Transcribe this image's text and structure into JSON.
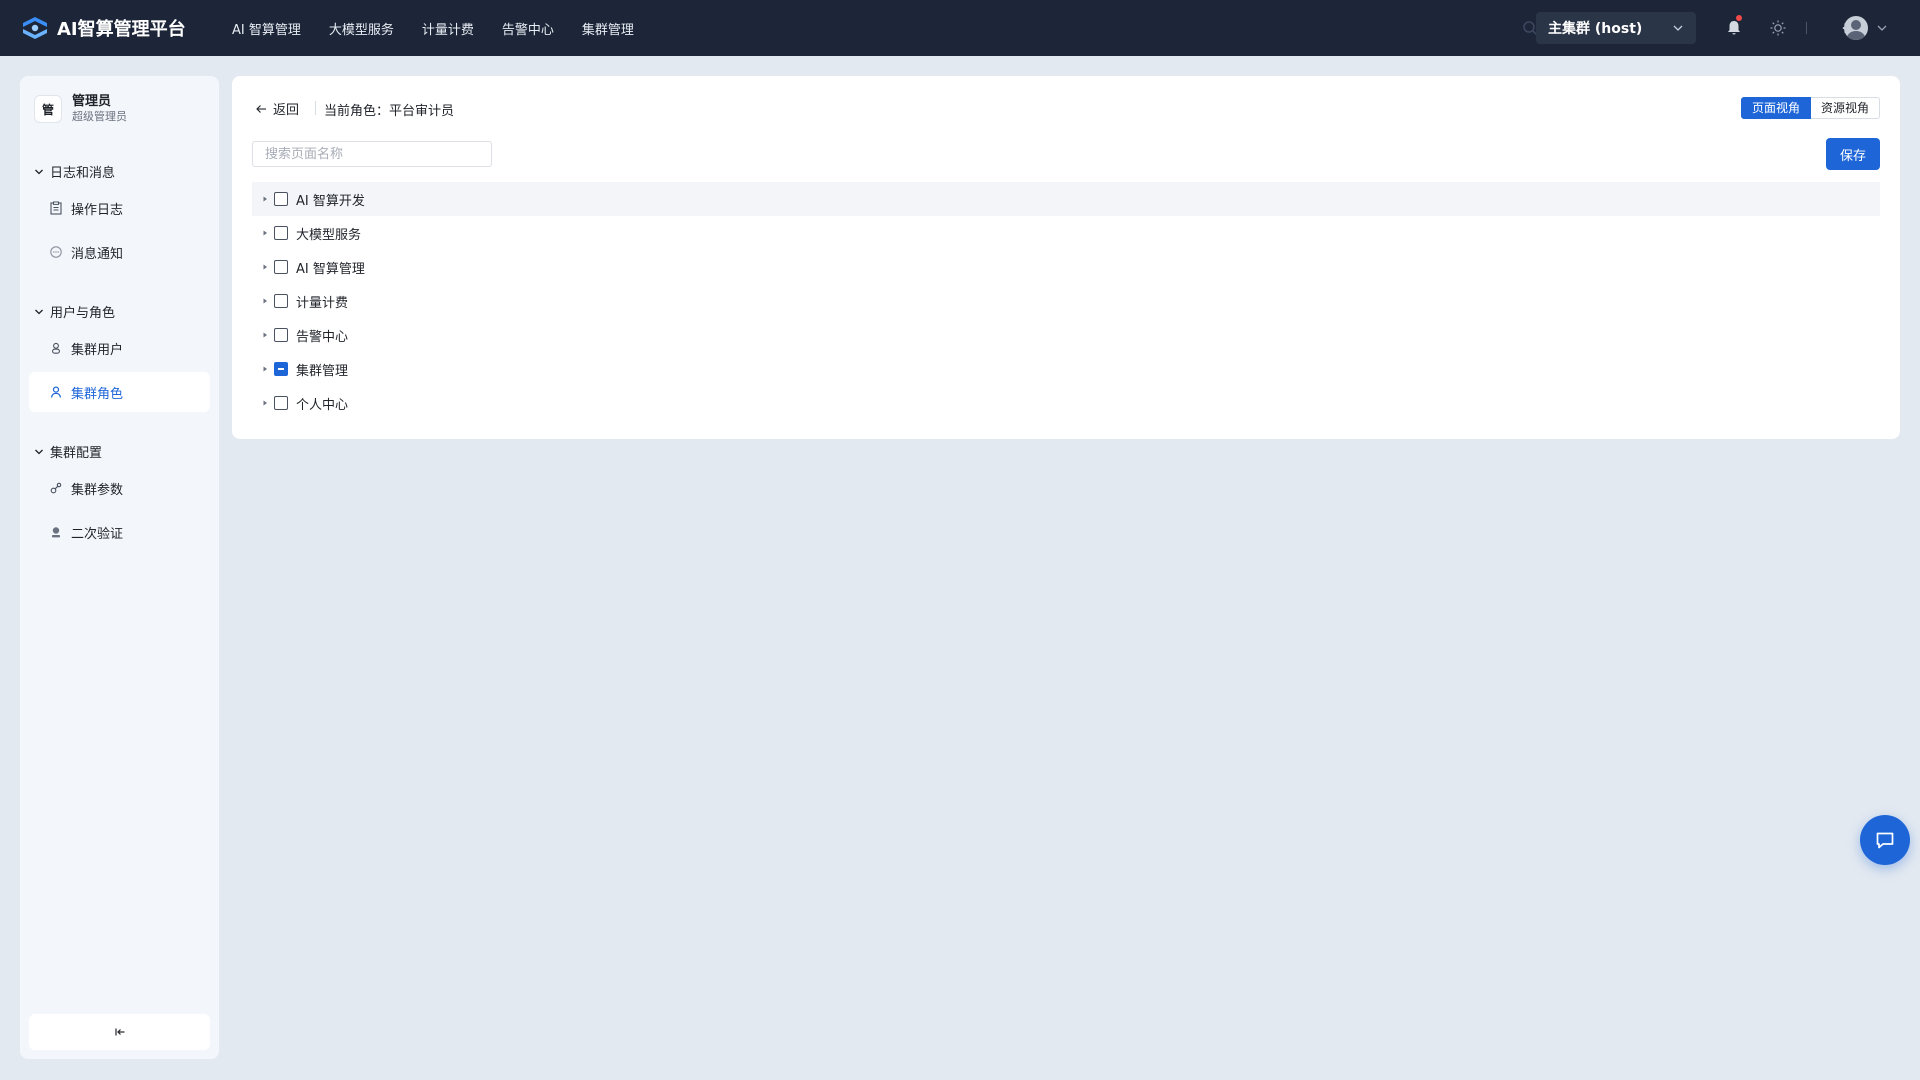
{
  "app": {
    "title": "AI智算管理平台",
    "nav": [
      "AI 智算管理",
      "大模型服务",
      "计量计费",
      "告警中心",
      "集群管理"
    ]
  },
  "header": {
    "cluster": "主集群 (host)"
  },
  "user": {
    "badge": "管",
    "name": "管理员",
    "role": "超级管理员"
  },
  "sidebar": {
    "groups": [
      {
        "title": "日志和消息",
        "items": [
          "操作日志",
          "消息通知"
        ]
      },
      {
        "title": "用户与角色",
        "items": [
          "集群用户",
          "集群角色"
        ]
      },
      {
        "title": "集群配置",
        "items": [
          "集群参数",
          "二次验证"
        ]
      }
    ],
    "active": "集群角色"
  },
  "main": {
    "back": "返回",
    "role_label": "当前角色：平台审计员",
    "view_page": "页面视角",
    "view_resource": "资源视角",
    "view_selected": "页面视角",
    "search_placeholder": "搜索页面名称",
    "save": "保存",
    "tree": [
      {
        "label": "AI 智算开发",
        "state": "unchecked"
      },
      {
        "label": "大模型服务",
        "state": "unchecked"
      },
      {
        "label": "AI 智算管理",
        "state": "unchecked"
      },
      {
        "label": "计量计费",
        "state": "unchecked"
      },
      {
        "label": "告警中心",
        "state": "unchecked"
      },
      {
        "label": "集群管理",
        "state": "indeterminate"
      },
      {
        "label": "个人中心",
        "state": "unchecked"
      }
    ]
  },
  "colors": {
    "topbar": "#1c2638",
    "accent": "#1e66d8",
    "page_bg": "#e3e9f1",
    "sidebar_bg": "#f3f6fa",
    "notify_dot": "#f04a4a"
  }
}
